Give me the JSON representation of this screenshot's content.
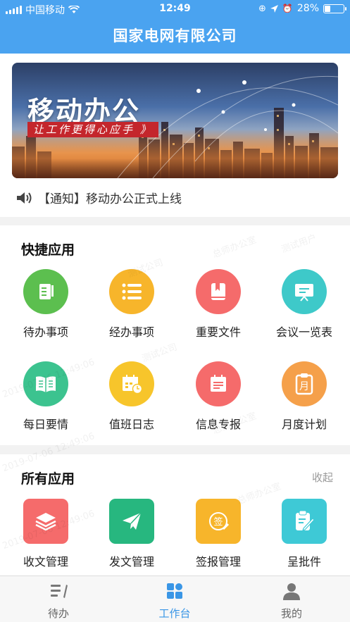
{
  "status": {
    "carrier": "中国移动",
    "time": "12:49",
    "battery": "28%",
    "battery_level": 0.28
  },
  "title": "国家电网有限公司",
  "banner": {
    "title": "移动办公",
    "subtitle": "让工作更得心应手 》"
  },
  "notice": "【通知】移动办公正式上线",
  "quick": {
    "title": "快捷应用",
    "apps": [
      {
        "label": "待办事项",
        "icon": "todo-icon",
        "color": "#5cbf4f"
      },
      {
        "label": "经办事项",
        "icon": "list-icon",
        "color": "#f7b52b"
      },
      {
        "label": "重要文件",
        "icon": "bookmark-file-icon",
        "color": "#f56b6b"
      },
      {
        "label": "会议一览表",
        "icon": "meeting-board-icon",
        "color": "#3ec9c9"
      },
      {
        "label": "每日要情",
        "icon": "open-book-icon",
        "color": "#3cc38f"
      },
      {
        "label": "值班日志",
        "icon": "calendar-clock-icon",
        "color": "#f7c52b"
      },
      {
        "label": "信息专报",
        "icon": "news-icon",
        "color": "#f56b6b"
      },
      {
        "label": "月度计划",
        "icon": "clipboard-month-icon",
        "color": "#f5a04a"
      }
    ],
    "month_char": "月"
  },
  "all": {
    "title": "所有应用",
    "collapse": "收起",
    "apps": [
      {
        "label": "收文管理",
        "icon": "layers-icon",
        "color": "#f56b6b"
      },
      {
        "label": "发文管理",
        "icon": "paper-plane-icon",
        "color": "#27b77f"
      },
      {
        "label": "签报管理",
        "icon": "sign-icon",
        "color": "#f7b52b"
      },
      {
        "label": "呈批件",
        "icon": "edit-doc-icon",
        "color": "#3ec9d6"
      }
    ],
    "sign_char": "签"
  },
  "tabs": [
    {
      "label": "待办",
      "icon": "todo-tab-icon",
      "active": false
    },
    {
      "label": "工作台",
      "icon": "workbench-icon",
      "active": true
    },
    {
      "label": "我的",
      "icon": "person-icon",
      "active": false
    }
  ],
  "watermark": [
    "测试公司",
    "总师办公室",
    "测试用户",
    "2019-07-06 12:49:06"
  ]
}
